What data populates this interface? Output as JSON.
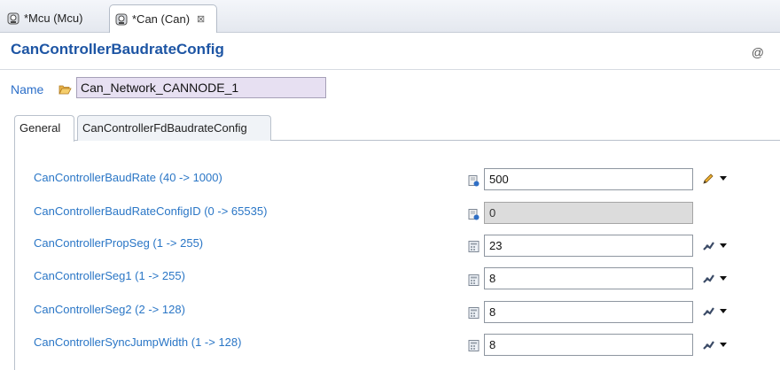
{
  "editor_tabs": [
    {
      "label": "*Mcu (Mcu)",
      "icon": "module-icon",
      "active": false
    },
    {
      "label": "*Can (Can)",
      "icon": "module-icon",
      "active": true,
      "close_glyph": "⊠"
    }
  ],
  "header": {
    "title": "CanControllerBaudrateConfig",
    "right_glyph": "@"
  },
  "name_field": {
    "label": "Name",
    "value": "Can_Network_CANNODE_1",
    "icon": "folder-icon"
  },
  "property_tabs": [
    {
      "label": "General",
      "active": true
    },
    {
      "label": "CanControllerFdBaudrateConfig",
      "active": false
    }
  ],
  "rows": [
    {
      "label": "CanControllerBaudRate (40 -> 1000)",
      "value": "500",
      "editable": true,
      "action_icon": "pencil-icon"
    },
    {
      "label": "CanControllerBaudRateConfigID (0 -> 65535)",
      "value": "0",
      "editable": false,
      "action_icon": ""
    },
    {
      "label": "CanControllerPropSeg (1 -> 255)",
      "value": "23",
      "editable": true,
      "action_icon": "calculate-icon"
    },
    {
      "label": "CanControllerSeg1 (1 -> 255)",
      "value": "8",
      "editable": true,
      "action_icon": "calculate-icon"
    },
    {
      "label": "CanControllerSeg2 (2 -> 128)",
      "value": "8",
      "editable": true,
      "action_icon": "calculate-icon"
    },
    {
      "label": "CanControllerSyncJumpWidth (1 -> 128)",
      "value": "8",
      "editable": true,
      "action_icon": "calculate-icon"
    }
  ],
  "colors": {
    "title": "#1d55a4",
    "label": "#2a76c6",
    "name_bg": "#e7e0f2",
    "disabled_bg": "#dcdcdc"
  }
}
